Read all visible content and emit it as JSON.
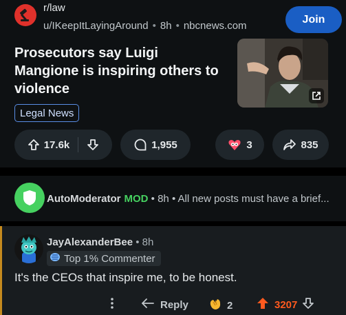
{
  "post": {
    "subreddit": "r/law",
    "author": "u/IKeepItLayingAround",
    "age": "8h",
    "domain": "nbcnews.com",
    "join_label": "Join",
    "title": "Prosecutors say Luigi Mangione is inspiring others to violence",
    "flair": "Legal News",
    "upvotes": "17.6k",
    "comments": "1,955",
    "awards": "3",
    "shares": "835"
  },
  "automod": {
    "name": "AutoModerator",
    "mod_badge": "MOD",
    "age": "8h",
    "preview": "All new posts must have a brief..."
  },
  "comment": {
    "author": "JayAlexanderBee",
    "age": "8h",
    "badge": "Top 1% Commenter",
    "body": "It's the CEOs that inspire me, to be honest.",
    "reply_label": "Reply",
    "awards": "2",
    "score": "3207"
  },
  "colors": {
    "background": "#0e1113",
    "join_button": "#1a5ec4",
    "flair_border": "#5a8ee6",
    "mod_green": "#46d160",
    "upvote_orange": "#ff5a1f",
    "subreddit_red": "#e0312b"
  }
}
